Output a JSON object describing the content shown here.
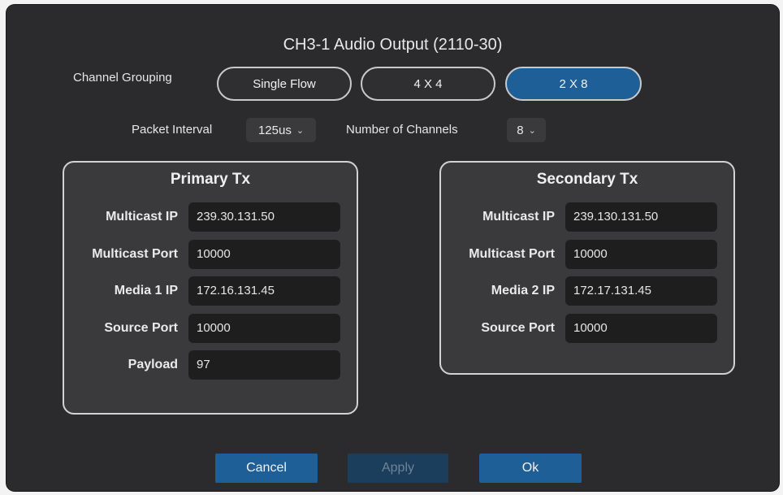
{
  "dialog": {
    "title": "CH3-1 Audio Output (2110-30)"
  },
  "channel_grouping": {
    "label": "Channel Grouping",
    "options": [
      "Single Flow",
      "4 X 4",
      "2 X 8"
    ],
    "selected": "2 X 8"
  },
  "packet_interval": {
    "label": "Packet Interval",
    "value": "125us"
  },
  "number_of_channels": {
    "label": "Number of Channels",
    "value": "8"
  },
  "primary_tx": {
    "title": "Primary Tx",
    "fields": [
      {
        "label": "Multicast IP",
        "value": "239.30.131.50"
      },
      {
        "label": "Multicast Port",
        "value": "10000"
      },
      {
        "label": "Media 1 IP",
        "value": "172.16.131.45"
      },
      {
        "label": "Source Port",
        "value": "10000"
      },
      {
        "label": "Payload",
        "value": "97"
      }
    ]
  },
  "secondary_tx": {
    "title": "Secondary Tx",
    "fields": [
      {
        "label": "Multicast IP",
        "value": "239.130.131.50"
      },
      {
        "label": "Multicast Port",
        "value": "10000"
      },
      {
        "label": "Media 2 IP",
        "value": "172.17.131.45"
      },
      {
        "label": "Source Port",
        "value": "10000"
      }
    ]
  },
  "buttons": {
    "cancel": "Cancel",
    "apply": "Apply",
    "ok": "Ok"
  },
  "colors": {
    "accent": "#1d5f96",
    "background": "#2b2b2d",
    "panel": "#3a3a3c"
  }
}
